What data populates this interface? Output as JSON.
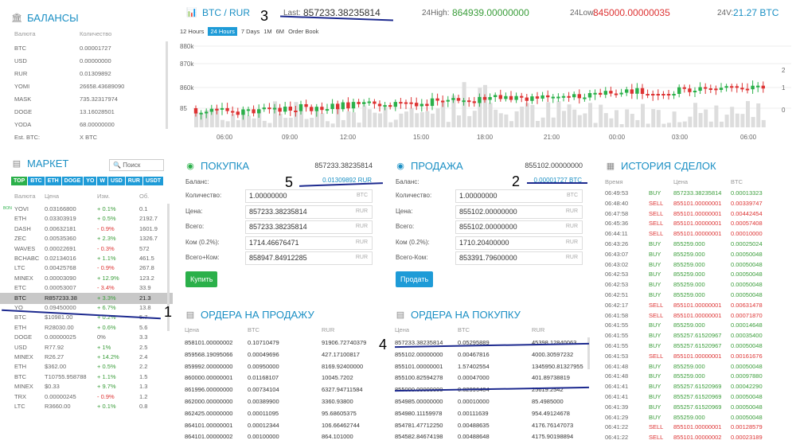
{
  "balances": {
    "title": "БАЛАНСЫ",
    "col_currency": "Валюта",
    "col_amount": "Количество",
    "rows": [
      [
        "BTC",
        "0.00001727"
      ],
      [
        "USD",
        "0.00000000"
      ],
      [
        "RUR",
        "0.01309892"
      ],
      [
        "YOMI",
        "26658.43689090"
      ],
      [
        "MASK",
        "735.32317974"
      ],
      [
        "DOGE",
        "13.16028501"
      ],
      [
        "YODA",
        "68.00000000"
      ]
    ],
    "est_label": "Est. BTC:",
    "est_value": "X BTC"
  },
  "market": {
    "title": "МАРКЕТ",
    "search_placeholder": "Поиск",
    "tabs": [
      "TOP",
      "BTC",
      "ETH",
      "DOGE",
      "YO",
      "W",
      "USD",
      "RUR",
      "USDT"
    ],
    "col_currency": "Валюта",
    "col_price": "Цена",
    "col_change": "Изм.",
    "col_volume": "Об.",
    "rows": [
      {
        "c": "YOVI",
        "p": "0.03166800",
        "ch": "+ 0.1%",
        "v": "0.1",
        "dir": "up",
        "badge": "BON"
      },
      {
        "c": "ETH",
        "p": "0.03303919",
        "ch": "+ 0.5%",
        "v": "2192.7",
        "dir": "up"
      },
      {
        "c": "DASH",
        "p": "0.00632181",
        "ch": "- 0.9%",
        "v": "1601.9",
        "dir": "down"
      },
      {
        "c": "ZEC",
        "p": "0.00535360",
        "ch": "+ 2.3%",
        "v": "1326.7",
        "dir": "up"
      },
      {
        "c": "WAVES",
        "p": "0.00022691",
        "ch": "- 0.3%",
        "v": "572",
        "dir": "down"
      },
      {
        "c": "BCHABC",
        "p": "0.02134016",
        "ch": "+ 1.1%",
        "v": "461.5",
        "dir": "up"
      },
      {
        "c": "LTC",
        "p": "0.00425768",
        "ch": "- 0.9%",
        "v": "267.8",
        "dir": "down"
      },
      {
        "c": "MINEX",
        "p": "0.00003090",
        "ch": "+ 12.9%",
        "v": "123.2",
        "dir": "up"
      },
      {
        "c": "ETC",
        "p": "0.00053007",
        "ch": "- 3.4%",
        "v": "33.9",
        "dir": "down"
      },
      {
        "c": "BTC",
        "p": "R857233.38",
        "ch": "+ 3.3%",
        "v": "21.3",
        "dir": "up",
        "sel": true
      },
      {
        "c": "YO",
        "p": "0.09450000",
        "ch": "+ 6.7%",
        "v": "13.8",
        "dir": "up"
      },
      {
        "c": "BTC",
        "p": "$10981.00",
        "ch": "+ 0.2%",
        "v": "5.7",
        "dir": "up"
      },
      {
        "c": "ETH",
        "p": "R28030.00",
        "ch": "+ 0.6%",
        "v": "5.6",
        "dir": "up"
      },
      {
        "c": "DOGE",
        "p": "0.00000025",
        "ch": "0%",
        "v": "3.3",
        "dir": "flat"
      },
      {
        "c": "USD",
        "p": "R77.92",
        "ch": "+ 1%",
        "v": "2.5",
        "dir": "up"
      },
      {
        "c": "MINEX",
        "p": "R26.27",
        "ch": "+ 14.2%",
        "v": "2.4",
        "dir": "up"
      },
      {
        "c": "ETH",
        "p": "$362.00",
        "ch": "+ 0.5%",
        "v": "2.2",
        "dir": "up"
      },
      {
        "c": "BTC",
        "p": "T10755.958788",
        "ch": "+ 1.1%",
        "v": "1.5",
        "dir": "up"
      },
      {
        "c": "MINEX",
        "p": "$0.33",
        "ch": "+ 9.7%",
        "v": "1.3",
        "dir": "up"
      },
      {
        "c": "TRX",
        "p": "0.00000245",
        "ch": "- 0.9%",
        "v": "1.2",
        "dir": "down"
      },
      {
        "c": "LTC",
        "p": "R3660.00",
        "ch": "+ 0.1%",
        "v": "0.8",
        "dir": "up"
      }
    ]
  },
  "ticker": {
    "pair": "BTC / RUR",
    "last_label": "Last:",
    "last": "857233.38235814",
    "high_label": "24High:",
    "high": "864939.00000000",
    "low_label": "24Low:",
    "low": "845000.00000035",
    "vol_label": "24V:",
    "vol": "21.27 BTC"
  },
  "ranges": [
    "12 Hours",
    "24 Hours",
    "7 Days",
    "1M",
    "6M",
    "Order Book"
  ],
  "chart_data": {
    "type": "candlestick",
    "y_ticks": [
      "880k",
      "870k",
      "860k",
      "85"
    ],
    "right_ticks": [
      "2",
      "1",
      "0"
    ],
    "x_ticks": [
      "06:00",
      "09:00",
      "12:00",
      "15:00",
      "18:00",
      "21:00",
      "00:00",
      "03:00",
      "06:00"
    ],
    "top_tick": "880k"
  },
  "buy": {
    "title": "ПОКУПКА",
    "price": "857233.38235814",
    "balance_label": "Баланс:",
    "balance": "0.01309892 RUR",
    "fields": [
      {
        "label": "Количество:",
        "value": "1.00000000",
        "cur": "BTC"
      },
      {
        "label": "Цена:",
        "value": "857233.38235814",
        "cur": "RUR"
      },
      {
        "label": "Всего:",
        "value": "857233.38235814",
        "cur": "RUR"
      },
      {
        "label": "Ком (0.2%):",
        "value": "1714.46676471",
        "cur": "RUR"
      },
      {
        "label": "Всего+Ком:",
        "value": "858947.84912285",
        "cur": "RUR"
      }
    ],
    "button": "Купить"
  },
  "sell": {
    "title": "ПРОДАЖА",
    "price": "855102.00000000",
    "balance_label": "Баланс:",
    "balance": "0.00001727 BTC",
    "fields": [
      {
        "label": "Количество:",
        "value": "1.00000000",
        "cur": "BTC"
      },
      {
        "label": "Цена:",
        "value": "855102.00000000",
        "cur": "RUR"
      },
      {
        "label": "Всего:",
        "value": "855102.00000000",
        "cur": "RUR"
      },
      {
        "label": "Ком (0.2%):",
        "value": "1710.20400000",
        "cur": "RUR"
      },
      {
        "label": "Всего-Ком:",
        "value": "853391.79600000",
        "cur": "RUR"
      }
    ],
    "button": "Продать"
  },
  "sell_orders": {
    "title": "ОРДЕРА НА ПРОДАЖУ",
    "cols": [
      "Цена",
      "BTC",
      "RUR"
    ],
    "rows": [
      [
        "858101.00000002",
        "0.10710479",
        "91906.72740379"
      ],
      [
        "859568.19095066",
        "0.00049696",
        "427.17100817"
      ],
      [
        "859992.00000000",
        "0.00950000",
        "8169.92400000"
      ],
      [
        "860000.00000001",
        "0.01168107",
        "10045.7202"
      ],
      [
        "861996.00000000",
        "0.00734104",
        "6327.94711584"
      ],
      [
        "862000.00000000",
        "0.00389900",
        "3360.93800"
      ],
      [
        "862425.00000000",
        "0.00011095",
        "95.68605375"
      ],
      [
        "864101.00000001",
        "0.00012344",
        "106.66462744"
      ],
      [
        "864101.00000002",
        "0.00100000",
        "864.101000"
      ]
    ]
  },
  "buy_orders": {
    "title": "ОРДЕРА НА ПОКУПКУ",
    "cols": [
      "Цена",
      "BTC",
      "RUR"
    ],
    "rows": [
      [
        "857233.38235814",
        "0.05295889",
        "45398.12840063"
      ],
      [
        "855102.00000000",
        "0.00467816",
        "4000.30597232"
      ],
      [
        "855101.00000001",
        "1.57402554",
        "1345950.81327955"
      ],
      [
        "855100.82594278",
        "0.00047000",
        "401.89738819"
      ],
      [
        "855000.00000000",
        "0.02996404",
        "25619.2542"
      ],
      [
        "854985.00000000",
        "0.00010000",
        "85.4985000"
      ],
      [
        "854980.11159978",
        "0.00111639",
        "954.49124678"
      ],
      [
        "854781.47712250",
        "0.00488635",
        "4176.76147073"
      ],
      [
        "854582.84674198",
        "0.00488648",
        "4175.90198894"
      ]
    ]
  },
  "history": {
    "title": "ИСТОРИЯ СДЕЛОК",
    "cols": [
      "Время",
      "",
      "Цена",
      "BTC"
    ],
    "rows": [
      [
        "06:49:53",
        "BUY",
        "857233.38235814",
        "0.00013323"
      ],
      [
        "06:48:40",
        "SELL",
        "855101.00000001",
        "0.00339747"
      ],
      [
        "06:47:58",
        "SELL",
        "855101.00000001",
        "0.00442454"
      ],
      [
        "06:45:36",
        "SELL",
        "855101.00000001",
        "0.00057408"
      ],
      [
        "06:44:11",
        "SELL",
        "855101.00000001",
        "0.00010000"
      ],
      [
        "06:43:26",
        "BUY",
        "855259.000",
        "0.00025024"
      ],
      [
        "06:43:07",
        "BUY",
        "855259.000",
        "0.00050048"
      ],
      [
        "06:43:02",
        "BUY",
        "855259.000",
        "0.00050048"
      ],
      [
        "06:42:53",
        "BUY",
        "855259.000",
        "0.00050048"
      ],
      [
        "06:42:53",
        "BUY",
        "855259.000",
        "0.00050048"
      ],
      [
        "06:42:51",
        "BUY",
        "855259.000",
        "0.00050048"
      ],
      [
        "06:42:17",
        "SELL",
        "855101.00000001",
        "0.00631478"
      ],
      [
        "06:41:58",
        "SELL",
        "855101.00000001",
        "0.00071870"
      ],
      [
        "06:41:55",
        "BUY",
        "855259.000",
        "0.00014648"
      ],
      [
        "06:41:55",
        "BUY",
        "855257.61520967",
        "0.00035400"
      ],
      [
        "06:41:55",
        "BUY",
        "855257.61520967",
        "0.00050048"
      ],
      [
        "06:41:53",
        "SELL",
        "855101.00000001",
        "0.00161676"
      ],
      [
        "06:41:48",
        "BUY",
        "855259.000",
        "0.00050048"
      ],
      [
        "06:41:48",
        "BUY",
        "855259.000",
        "0.00097880"
      ],
      [
        "06:41:41",
        "BUY",
        "855257.61520969",
        "0.00042290"
      ],
      [
        "06:41:41",
        "BUY",
        "855257.61520969",
        "0.00050048"
      ],
      [
        "06:41:39",
        "BUY",
        "855257.61520969",
        "0.00050048"
      ],
      [
        "06:41:29",
        "BUY",
        "855259.000",
        "0.00050048"
      ],
      [
        "06:41:22",
        "SELL",
        "855101.00000001",
        "0.00128579"
      ],
      [
        "06:41:22",
        "SELL",
        "855101.00000002",
        "0.00023189"
      ]
    ]
  },
  "annotations": [
    "1",
    "2",
    "3",
    "4",
    "5"
  ],
  "colors": {
    "accent": "#1a8fc4",
    "green": "#2bb04a",
    "red": "#d33"
  }
}
